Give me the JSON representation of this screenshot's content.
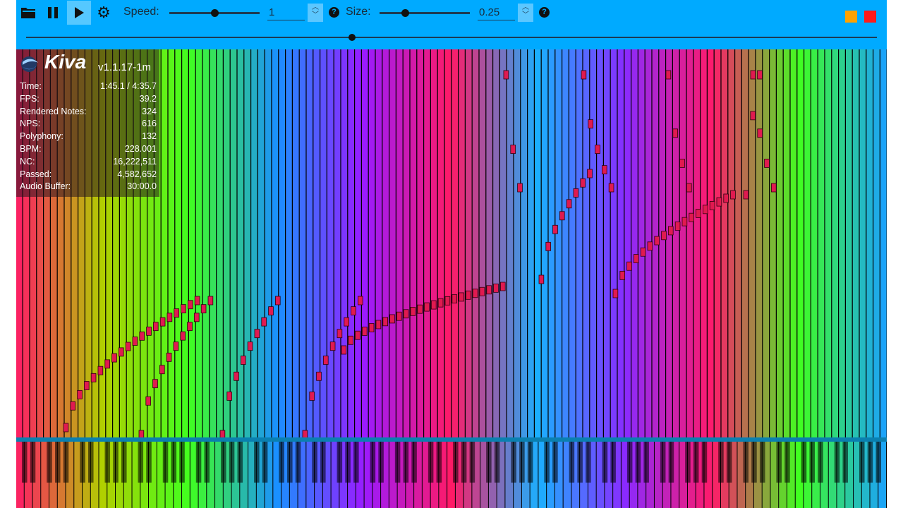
{
  "toolbar": {
    "speed_label": "Speed:",
    "speed_value": "1",
    "speed_level": 0.5,
    "size_label": "Size:",
    "size_value": "0.25",
    "size_level": 0.28,
    "seek_progress": 0.383,
    "minimize_color": "#ffa200",
    "close_color": "#ff1a1a"
  },
  "overlay": {
    "brand": "Kiva",
    "version": "v1.1.17-1m",
    "stats": [
      {
        "label": "Time:",
        "value": "1:45.1 / 4:35.7"
      },
      {
        "label": "FPS:",
        "value": "39.2"
      },
      {
        "label": "Rendered Notes:",
        "value": "324"
      },
      {
        "label": "NPS:",
        "value": "616"
      },
      {
        "label": "Polyphony:",
        "value": "132"
      },
      {
        "label": "BPM:",
        "value": "228.001"
      },
      {
        "label": "NC:",
        "value": "16,222,511"
      },
      {
        "label": "Passed:",
        "value": "4,582,652"
      },
      {
        "label": "Audio Buffer:",
        "value": "30:00.0"
      }
    ]
  },
  "colors": {
    "toolbar": "#00aaff",
    "track_colors": [
      "#ff1a66",
      "#b0d000",
      "#40ff20",
      "#1a90ff",
      "#9a1aff",
      "#ff1a66",
      "#1ab0ff",
      "#8a2aff",
      "#ff1a6a",
      "#40ff20",
      "#1aa0ff"
    ]
  }
}
